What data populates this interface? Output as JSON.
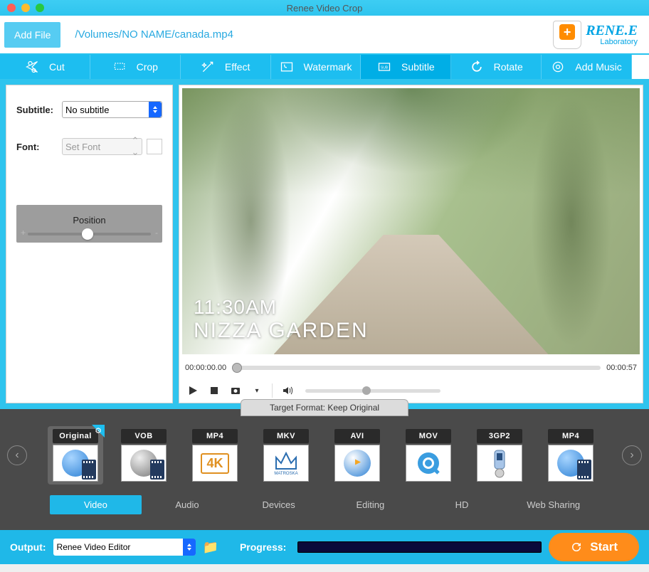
{
  "window": {
    "title": "Renee Video Crop"
  },
  "header": {
    "add_file": "Add File",
    "file_path": "/Volumes/NO NAME/canada.mp4",
    "brand": "RENE.E",
    "brand_sub": "Laboratory"
  },
  "tools": {
    "cut": "Cut",
    "crop": "Crop",
    "effect": "Effect",
    "watermark": "Watermark",
    "subtitle": "Subtitle",
    "rotate": "Rotate",
    "add_music": "Add Music"
  },
  "subtitle_panel": {
    "subtitle_label": "Subtitle:",
    "subtitle_value": "No subtitle",
    "font_label": "Font:",
    "font_placeholder": "Set Font",
    "position_label": "Position"
  },
  "preview": {
    "overlay_time": "11:30AM",
    "overlay_caption": "NIZZA GARDEN"
  },
  "timeline": {
    "start": "00:00:00.00",
    "end": "00:00:57"
  },
  "target_format": {
    "header": "Target Format: Keep Original",
    "items": [
      {
        "badge": "Original"
      },
      {
        "badge": "VOB"
      },
      {
        "badge": "MP4"
      },
      {
        "badge": "MKV"
      },
      {
        "badge": "AVI"
      },
      {
        "badge": "MOV"
      },
      {
        "badge": "3GP2"
      },
      {
        "badge": "MP4"
      }
    ],
    "mkv_sub": "MATROSKA"
  },
  "categories": {
    "video": "Video",
    "audio": "Audio",
    "devices": "Devices",
    "editing": "Editing",
    "hd": "HD",
    "web": "Web Sharing"
  },
  "footer": {
    "output_label": "Output:",
    "output_value": "Renee Video Editor",
    "progress_label": "Progress:",
    "start": "Start"
  }
}
